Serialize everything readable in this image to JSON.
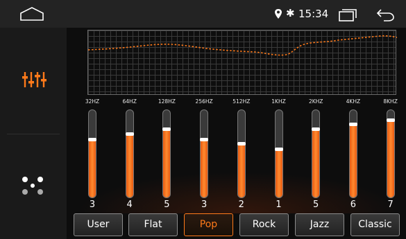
{
  "status": {
    "time": "15:34",
    "bluetooth_glyph": "✱"
  },
  "sidebar": {
    "items": [
      {
        "name": "equalizer-icon",
        "active": true
      },
      {
        "name": "surround-icon",
        "active": false
      }
    ]
  },
  "eq": {
    "bands": [
      {
        "freq": "32HZ",
        "value": "3",
        "level": 0.66
      },
      {
        "freq": "64HZ",
        "value": "4",
        "level": 0.72
      },
      {
        "freq": "128HZ",
        "value": "5",
        "level": 0.78
      },
      {
        "freq": "256HZ",
        "value": "3",
        "level": 0.66
      },
      {
        "freq": "512HZ",
        "value": "2",
        "level": 0.61
      },
      {
        "freq": "1KHZ",
        "value": "1",
        "level": 0.55
      },
      {
        "freq": "2KHZ",
        "value": "5",
        "level": 0.78
      },
      {
        "freq": "4KHZ",
        "value": "6",
        "level": 0.83
      },
      {
        "freq": "8KHZ",
        "value": "7",
        "level": 0.88
      }
    ]
  },
  "presets": [
    {
      "label": "User",
      "active": false
    },
    {
      "label": "Flat",
      "active": false
    },
    {
      "label": "Pop",
      "active": true
    },
    {
      "label": "Rock",
      "active": false
    },
    {
      "label": "Jazz",
      "active": false
    },
    {
      "label": "Classic",
      "active": false
    }
  ],
  "colors": {
    "accent": "#ff7a1a",
    "bar": "#ff8a30"
  }
}
